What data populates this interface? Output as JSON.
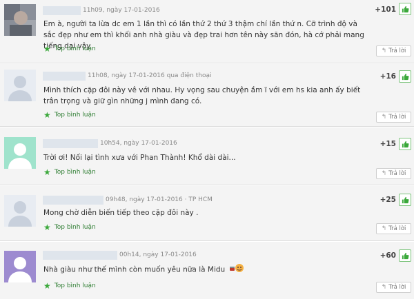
{
  "comments": [
    {
      "meta": "11h09, ngày 17-01-2016",
      "text": "Em à, người ta lừa dc em 1 lần thì có lần thứ 2 thứ 3 thậm chí lần thứ n. Cỡ trình độ và sắc đẹp như em thì khối anh nhà giàu và đẹp trai hơn tên này săn đón, hà cớ phải mang tiếng dại vậy.",
      "score": "+101",
      "top_label": "Top bình luận",
      "reply_label": "Trả lời"
    },
    {
      "meta": "11h08, ngày 17-01-2016 qua điện thoại",
      "text": "Mình thích cặp đôi này vê với nhau. Hy vọng sau chuyện ầm ĩ với em hs kia anh ấy biết trân trọng và giữ gìn những j mình đang có.",
      "score": "+16",
      "top_label": "Top bình luận",
      "reply_label": "Trả lời"
    },
    {
      "meta": "10h54, ngày 17-01-2016",
      "text": "Trời ơi! Nối lại tình xưa với Phan Thành! Khổ dài dài...",
      "score": "+15",
      "top_label": "Top bình luận",
      "reply_label": "Trả lời"
    },
    {
      "meta": "09h48, ngày 17-01-2016 · TP HCM",
      "text": "Mong chờ diễn biến tiếp theo cặp đôi này .",
      "score": "+25",
      "top_label": "Top bình luận",
      "reply_label": "Trả lời"
    },
    {
      "meta": "00h14, ngày 17-01-2016",
      "text": "Nhà giàu như thế mình còn muốn yêu nữa là Midu",
      "score": "+60",
      "top_label": "Top bình luận",
      "reply_label": "Trả lời"
    }
  ],
  "colors": {
    "top_green": "#2e7d32",
    "like_border": "#7cc47c",
    "avatar_mint": "#7fd6b8",
    "avatar_purple": "#8e7cc3",
    "avatar_gray": "#c8d0dc"
  },
  "icons": {
    "star": "star-icon",
    "like": "thumbs-up-icon",
    "reply": "reply-arrow-icon",
    "emoji": "smiley-emoji-icon"
  }
}
